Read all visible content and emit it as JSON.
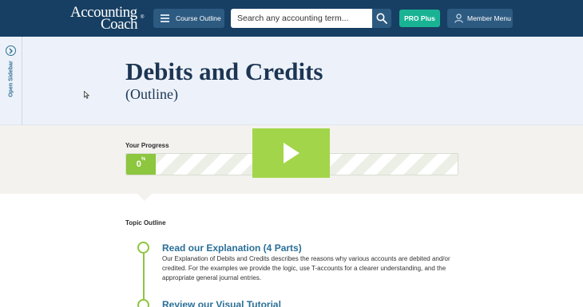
{
  "header": {
    "logo_line1": "Accounting",
    "logo_line2": "Coach",
    "logo_reg": "®",
    "course_outline_label": "Course Outline",
    "search_placeholder": "Search any accounting term...",
    "pro_plus_label": "PRO Plus",
    "member_menu_label": "Member Menu"
  },
  "sidebar": {
    "toggle_label": "Open Sidebar"
  },
  "page": {
    "title": "Debits and Credits",
    "subtitle": "(Outline)"
  },
  "progress": {
    "label": "Your Progress",
    "value_number": "0",
    "value_unit": "%",
    "fraction": 0
  },
  "outline": {
    "heading": "Topic Outline",
    "items": [
      {
        "title": "Read our Explanation (4 Parts)",
        "description": "Our Explanation of Debits and Credits describes the reasons why various accounts are debited and/or credited. For the examples we provide the logic, use T-accounts for a clearer understanding, and the appropriate general journal entries."
      },
      {
        "title": "Review our Visual Tutorial",
        "description": ""
      }
    ]
  },
  "colors": {
    "header_bg": "#173f63",
    "accent_green": "#8dc63f",
    "pro_teal": "#19b394",
    "link_blue": "#2a6f97"
  },
  "icons": [
    "list-icon",
    "search-icon",
    "user-icon",
    "chevron-right-circle-icon",
    "play-icon",
    "cursor-icon"
  ]
}
